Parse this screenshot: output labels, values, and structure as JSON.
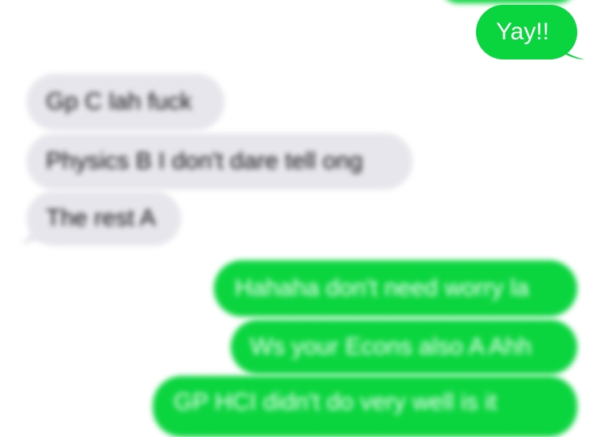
{
  "conversation": {
    "messages": [
      {
        "direction": "outgoing",
        "text": ""
      },
      {
        "direction": "outgoing",
        "text": "Yay!!"
      },
      {
        "direction": "incoming",
        "text": "Gp C lah fuck"
      },
      {
        "direction": "incoming",
        "text": "Physics B I don't dare tell ong"
      },
      {
        "direction": "incoming",
        "text": "The rest A"
      },
      {
        "direction": "outgoing",
        "text": "Hahaha don't need worry la"
      },
      {
        "direction": "outgoing",
        "text": "Ws your Econs also A Ahh"
      },
      {
        "direction": "outgoing",
        "text": "GP HCI didn't do very well is it"
      }
    ]
  },
  "colors": {
    "outgoing_bubble": "#0ad53e",
    "incoming_bubble": "#e6e6ec",
    "outgoing_text": "#ffffff",
    "incoming_text": "#111111"
  }
}
